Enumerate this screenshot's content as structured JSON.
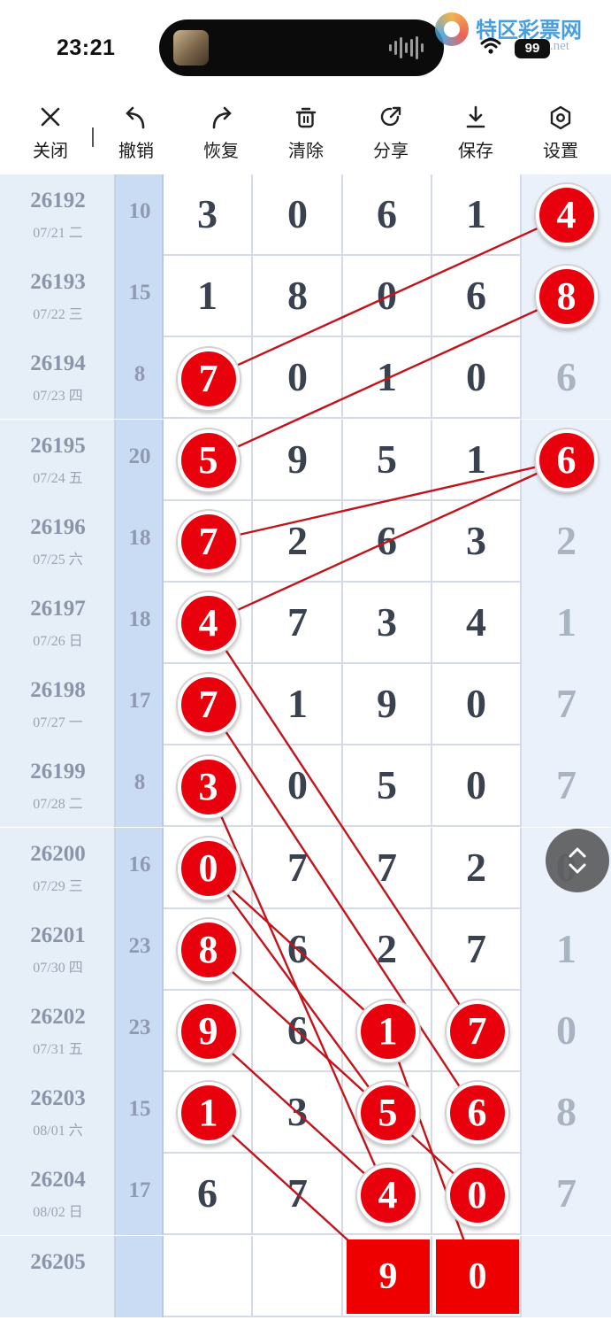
{
  "status_bar": {
    "time": "23:21",
    "battery": "99"
  },
  "watermark": {
    "text": "特区彩票网",
    "url": "tqcp.net"
  },
  "toolbar": {
    "close": "关闭",
    "undo": "撤销",
    "redo": "恢复",
    "clear": "清除",
    "share": "分享",
    "save": "保存",
    "settings": "设置"
  },
  "rows": [
    {
      "issue": "26192",
      "date": "07/21 二",
      "sum": "10",
      "nums": [
        "3",
        "0",
        "6",
        "1"
      ],
      "last": "4"
    },
    {
      "issue": "26193",
      "date": "07/22 三",
      "sum": "15",
      "nums": [
        "1",
        "8",
        "0",
        "6"
      ],
      "last": "8"
    },
    {
      "issue": "26194",
      "date": "07/23 四",
      "sum": "8",
      "nums": [
        "7",
        "0",
        "1",
        "0"
      ],
      "last": "6"
    },
    {
      "issue": "26195",
      "date": "07/24 五",
      "sum": "20",
      "nums": [
        "5",
        "9",
        "5",
        "1"
      ],
      "last": "6"
    },
    {
      "issue": "26196",
      "date": "07/25 六",
      "sum": "18",
      "nums": [
        "7",
        "2",
        "6",
        "3"
      ],
      "last": "2"
    },
    {
      "issue": "26197",
      "date": "07/26 日",
      "sum": "18",
      "nums": [
        "4",
        "7",
        "3",
        "4"
      ],
      "last": "1"
    },
    {
      "issue": "26198",
      "date": "07/27 一",
      "sum": "17",
      "nums": [
        "7",
        "1",
        "9",
        "0"
      ],
      "last": "7"
    },
    {
      "issue": "26199",
      "date": "07/28 二",
      "sum": "8",
      "nums": [
        "3",
        "0",
        "5",
        "0"
      ],
      "last": "7"
    },
    {
      "issue": "26200",
      "date": "07/29 三",
      "sum": "16",
      "nums": [
        "0",
        "7",
        "7",
        "2"
      ],
      "last": "0"
    },
    {
      "issue": "26201",
      "date": "07/30 四",
      "sum": "23",
      "nums": [
        "8",
        "6",
        "2",
        "7"
      ],
      "last": "1"
    },
    {
      "issue": "26202",
      "date": "07/31 五",
      "sum": "23",
      "nums": [
        "9",
        "6",
        "1",
        "7"
      ],
      "last": "0"
    },
    {
      "issue": "26203",
      "date": "08/01 六",
      "sum": "15",
      "nums": [
        "1",
        "3",
        "5",
        "6"
      ],
      "last": "8"
    },
    {
      "issue": "26204",
      "date": "08/02 日",
      "sum": "17",
      "nums": [
        "6",
        "7",
        "4",
        "0"
      ],
      "last": "7"
    },
    {
      "issue": "26205",
      "date": "",
      "sum": "",
      "nums": [
        "",
        "",
        "9",
        "0"
      ],
      "last": ""
    }
  ],
  "highlights": [
    {
      "row": 0,
      "col": 4
    },
    {
      "row": 1,
      "col": 4
    },
    {
      "row": 3,
      "col": 4
    },
    {
      "row": 3,
      "col": 4
    },
    {
      "row": 2,
      "col": 0
    },
    {
      "row": 3,
      "col": 0
    },
    {
      "row": 4,
      "col": 0
    },
    {
      "row": 5,
      "col": 0
    },
    {
      "row": 6,
      "col": 0
    },
    {
      "row": 7,
      "col": 0
    },
    {
      "row": 8,
      "col": 0
    },
    {
      "row": 9,
      "col": 0
    },
    {
      "row": 10,
      "col": 0
    },
    {
      "row": 11,
      "col": 0
    },
    {
      "row": 10,
      "col": 2
    },
    {
      "row": 10,
      "col": 3
    },
    {
      "row": 11,
      "col": 2
    },
    {
      "row": 11,
      "col": 3
    },
    {
      "row": 12,
      "col": 2
    },
    {
      "row": 12,
      "col": 3
    }
  ],
  "accent_color": "#e8000c"
}
